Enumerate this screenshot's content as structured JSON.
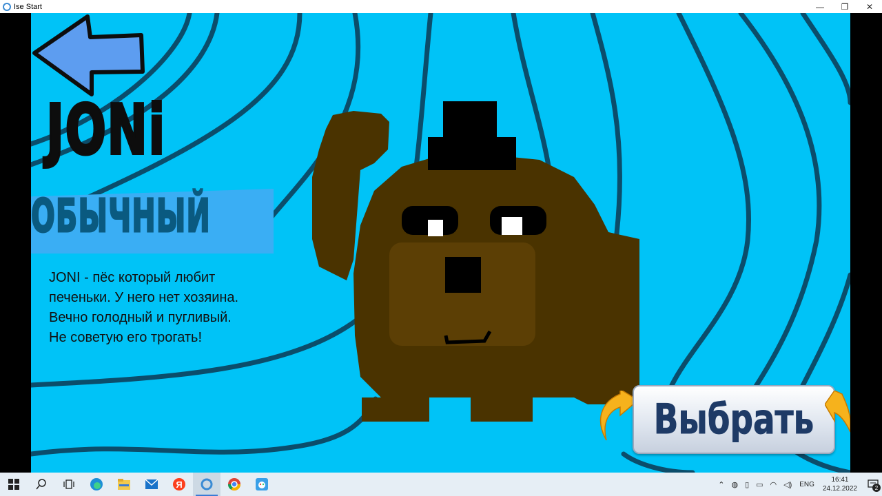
{
  "window": {
    "title": "Ise Start",
    "minimize": "—",
    "restore": "❐",
    "close": "✕"
  },
  "game": {
    "character_name": "JONi",
    "rarity": "ОБЫЧНЫЙ",
    "description": "JONI - пёс который любит печеньки. У него нет хозяина. Вечно голодный и пугливый. Не советую его трогать!",
    "select_label": "Выбрать",
    "colors": {
      "background": "#00c3f7",
      "lines": "#0b4d6b",
      "character_body": "#4a3300",
      "character_face": "#5c3f05",
      "back_arrow": "#5d9df0"
    }
  },
  "taskbar": {
    "icons": [
      "windows-start-icon",
      "search-icon",
      "task-view-icon",
      "edge-icon",
      "file-explorer-icon",
      "mail-icon",
      "yandex-icon",
      "ise-start-icon",
      "chrome-icon",
      "paint-icon"
    ],
    "tray": {
      "language": "ENG",
      "time": "16:41",
      "date": "24.12.2022",
      "notifications": "2"
    }
  }
}
